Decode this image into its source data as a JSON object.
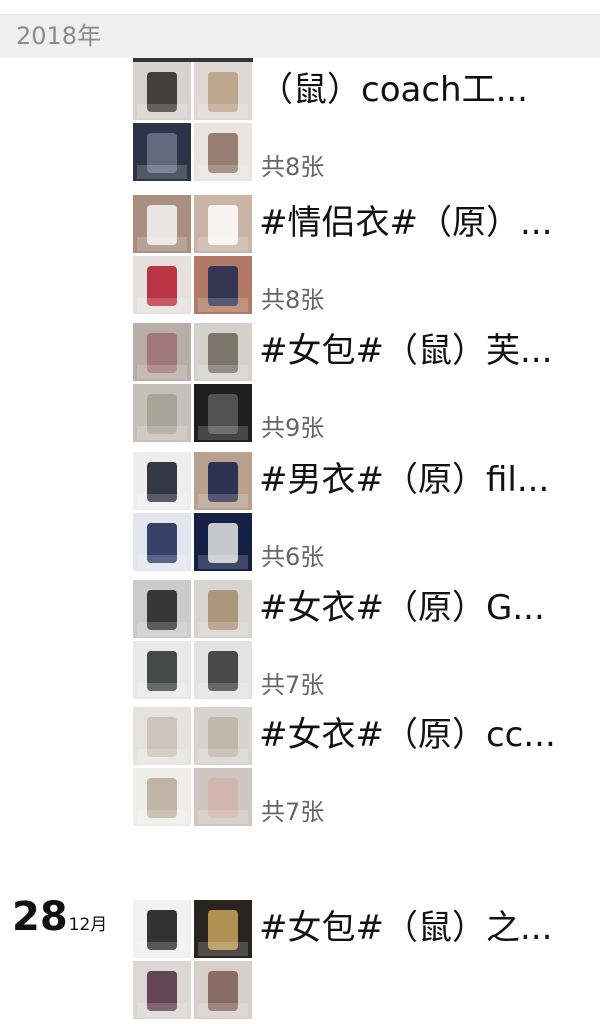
{
  "year_header": "2018年",
  "posts": [
    {
      "title": "（鼠）coach工...",
      "count": "共8张",
      "thumbs": [
        {
          "icon": "wallet-boxes-photo",
          "bg": "#d8d2cf",
          "fg": "#2c2422"
        },
        {
          "icon": "lanyard-cards-photo",
          "bg": "#e0d9d3",
          "fg": "#b79b80"
        },
        {
          "icon": "gift-box-photo",
          "bg": "#2b3546",
          "fg": "#6a7389"
        },
        {
          "icon": "pouch-photo",
          "bg": "#e9e4e0",
          "fg": "#8a6c5c"
        }
      ]
    },
    {
      "title": "#情侣衣#（原）...",
      "count": "共8张",
      "thumbs": [
        {
          "icon": "fila-jacket-photo",
          "bg": "#a88f7f",
          "fg": "#f3f3f3"
        },
        {
          "icon": "fila-jacket-front-photo",
          "bg": "#c9b5a6",
          "fg": "#ffffff"
        },
        {
          "icon": "fila-jacket-detail-photo",
          "bg": "#e6e1df",
          "fg": "#b3172a"
        },
        {
          "icon": "fila-jacket-worn-photo",
          "bg": "#b27a64",
          "fg": "#1d2850"
        }
      ]
    },
    {
      "title": "#女包#（鼠）芙...",
      "count": "共9张",
      "thumbs": [
        {
          "icon": "snakeskin-bag-photo",
          "bg": "#b9aea7",
          "fg": "#9c6f72"
        },
        {
          "icon": "snakeskin-bag-2-photo",
          "bg": "#d6d0ca",
          "fg": "#6f6559"
        },
        {
          "icon": "snakeskin-bag-3-photo",
          "bg": "#c7c0b8",
          "fg": "#a59d90"
        },
        {
          "icon": "quilted-leather-photo",
          "bg": "#1e1e1e",
          "fg": "#5a5a5a"
        }
      ]
    },
    {
      "title": "#男衣#（原）fil...",
      "count": "共6张",
      "thumbs": [
        {
          "icon": "track-pants-photo",
          "bg": "#eeeeee",
          "fg": "#111827"
        },
        {
          "icon": "track-pants-worn-photo",
          "bg": "#b9a18f",
          "fg": "#15204a"
        },
        {
          "icon": "fila-label-photo",
          "bg": "#e3e6ee",
          "fg": "#1a2550"
        },
        {
          "icon": "pants-stripe-photo",
          "bg": "#152046",
          "fg": "#e6e6e6"
        }
      ]
    },
    {
      "title": "#女衣#（原）G...",
      "count": "共7张",
      "thumbs": [
        {
          "icon": "black-coat-mirror-photo",
          "bg": "#cbcbcb",
          "fg": "#1d1d1d"
        },
        {
          "icon": "fur-hood-selfie-photo",
          "bg": "#d8d4d0",
          "fg": "#a48c6f"
        },
        {
          "icon": "down-jacket-photo",
          "bg": "#e9e9e9",
          "fg": "#2a2d2c"
        },
        {
          "icon": "down-jacket-2-photo",
          "bg": "#e3e3e3",
          "fg": "#2e2e2e"
        }
      ]
    },
    {
      "title": "#女衣#（原）cc...",
      "count": "共7张",
      "thumbs": [
        {
          "icon": "beige-long-coat-photo",
          "bg": "#e6e3df",
          "fg": "#c8bfb4"
        },
        {
          "icon": "beige-puffer-photo",
          "bg": "#d7d3ce",
          "fg": "#bdb3a6"
        },
        {
          "icon": "fur-collar-photo",
          "bg": "#efedea",
          "fg": "#b7a99b"
        },
        {
          "icon": "pink-coat-worn-photo",
          "bg": "#cfc6c1",
          "fg": "#d1b2aa"
        }
      ]
    },
    {
      "title": "#女包#（鼠）之...",
      "count": "",
      "thumbs": [
        {
          "icon": "black-chain-bag-photo",
          "bg": "#f1f1f1",
          "fg": "#111111"
        },
        {
          "icon": "gold-bag-photo",
          "bg": "#2a2420",
          "fg": "#c9a45a"
        },
        {
          "icon": "purple-bag-photo",
          "bg": "#dcd6d6",
          "fg": "#4e2b3c"
        },
        {
          "icon": "bag-detail-photo",
          "bg": "#d7cfc9",
          "fg": "#7a5b53"
        }
      ]
    }
  ],
  "date": {
    "day": "28",
    "month": "12月"
  }
}
